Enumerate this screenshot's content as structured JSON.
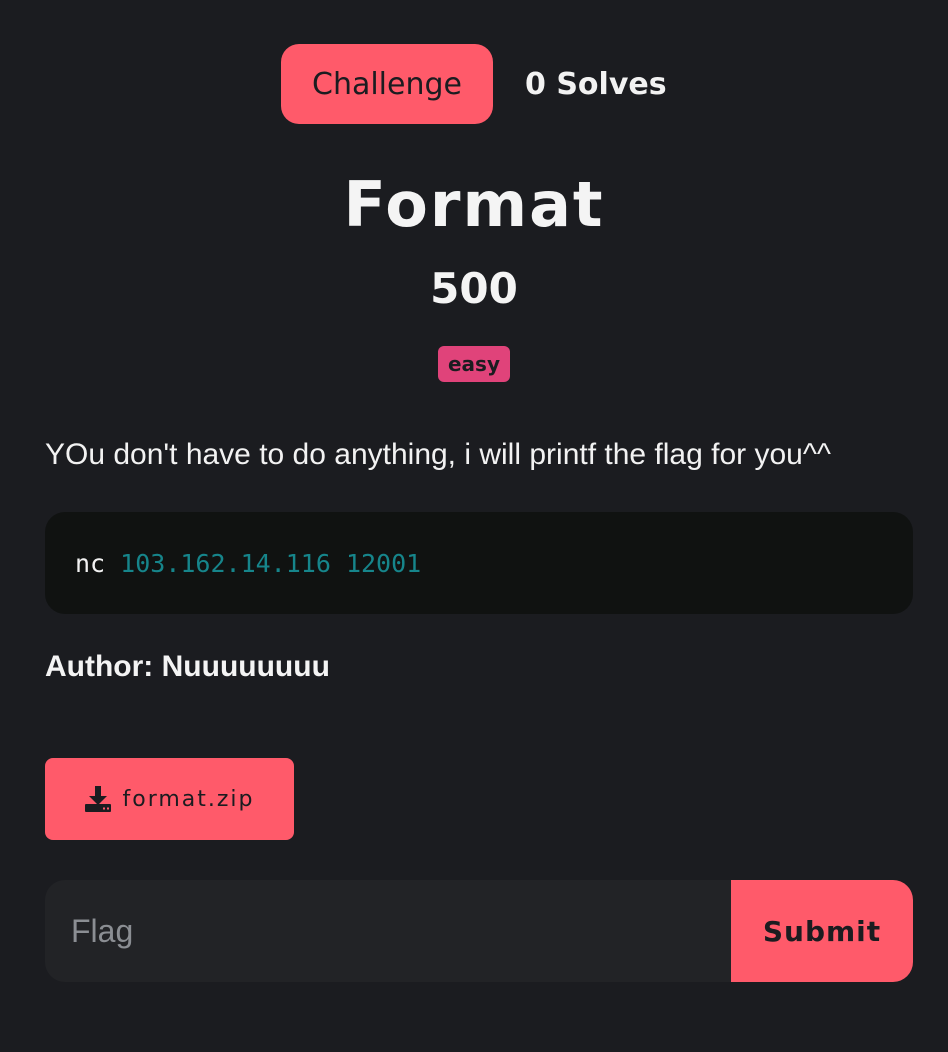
{
  "tabs": {
    "challenge_label": "Challenge",
    "solves_label": "0 Solves"
  },
  "challenge": {
    "name": "Format",
    "points": "500",
    "difficulty": "easy",
    "description": "YOu don't have to do anything, i will printf the flag for you^^",
    "code": {
      "command": "nc",
      "args": "103.162.14.116 12001"
    },
    "author": "Author: Nuuuuuuuu",
    "file": {
      "icon": "download-icon",
      "name": "format.zip"
    }
  },
  "flag_form": {
    "placeholder": "Flag",
    "value": "",
    "submit_label": "Submit"
  },
  "colors": {
    "background": "#1b1c20",
    "accent": "#ff5a6a",
    "badge": "#e0437a",
    "code_bg": "#101211",
    "code_args": "#16858b",
    "input_bg": "#222326"
  }
}
